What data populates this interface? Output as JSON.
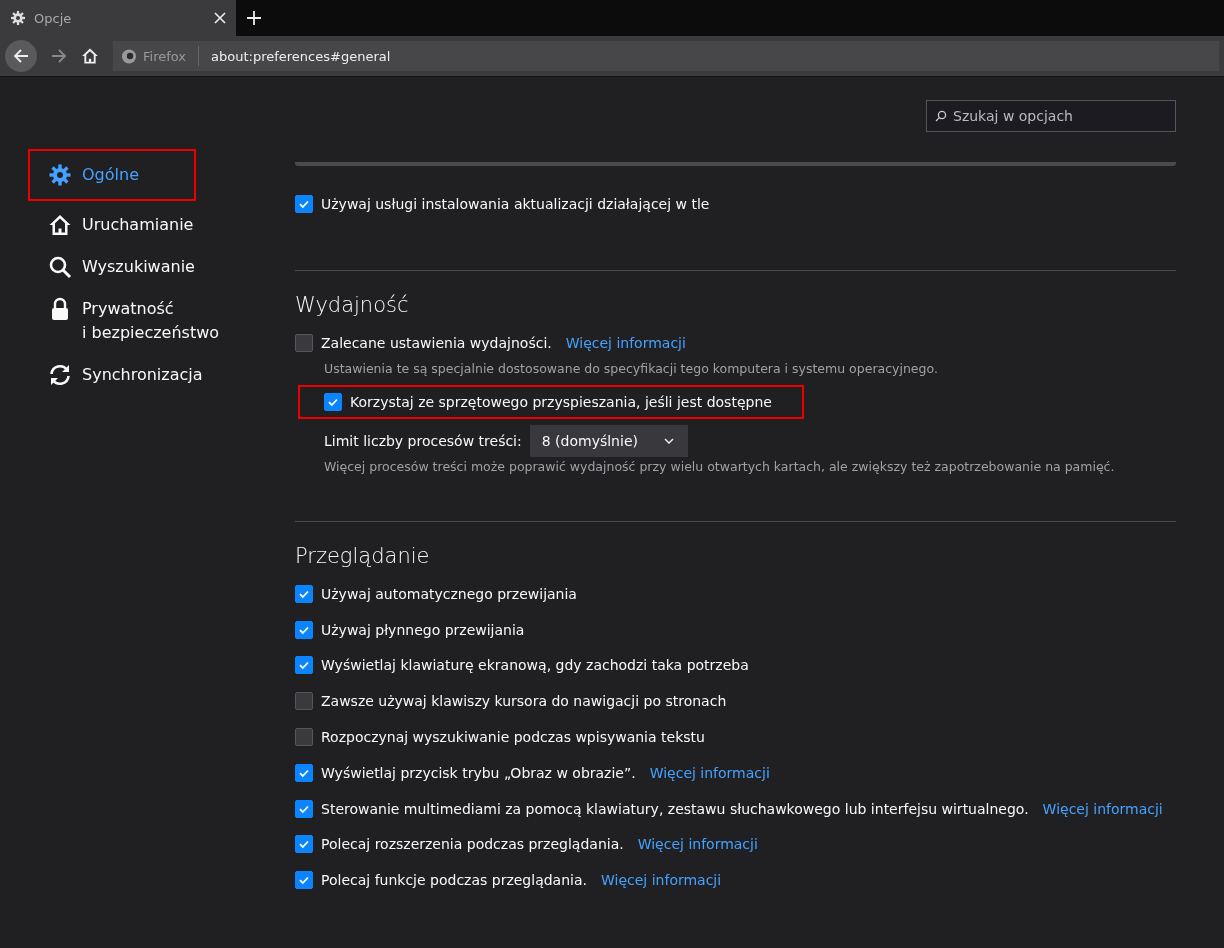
{
  "tabs": [
    {
      "label": "Opcje",
      "selected": true
    }
  ],
  "toolbar": {
    "identity": "Firefox",
    "url": "about:preferences#general"
  },
  "search": {
    "placeholder": "Szukaj w opcjach"
  },
  "sidebar": {
    "items": [
      {
        "label": "Ogólne",
        "selected": true,
        "highlighted": true
      },
      {
        "label": "Uruchamianie",
        "selected": false,
        "highlighted": false
      },
      {
        "label": "Wyszukiwanie",
        "selected": false,
        "highlighted": false
      },
      {
        "label": "Prywatność\ni bezpieczeństwo",
        "selected": false,
        "highlighted": false
      },
      {
        "label": "Synchronizacja",
        "selected": false,
        "highlighted": false
      }
    ]
  },
  "updates": {
    "label": "Używaj usługi instalowania aktualizacji działającej w tle",
    "checked": true
  },
  "performance": {
    "title": "Wydajność",
    "recommended": {
      "label": "Zalecane ustawienia wydajności.",
      "link": "Więcej informacji",
      "checked": false
    },
    "recommended_note": "Ustawienia te są specjalnie dostosowane do specyfikacji tego komputera i systemu operacyjnego.",
    "hardware": {
      "label": "Korzystaj ze sprzętowego przyspieszania, jeśli jest dostępne",
      "checked": true,
      "highlighted": true
    },
    "process_limit": {
      "label": "Limit liczby procesów treści:",
      "value": "8 (domyślnie)"
    },
    "process_note": "Więcej procesów treści może poprawić wydajność przy wielu otwartych kartach, ale zwiększy też zapotrzebowanie na pamięć."
  },
  "browsing": {
    "title": "Przeglądanie",
    "options": [
      {
        "label": "Używaj automatycznego przewijania",
        "checked": true
      },
      {
        "label": "Używaj płynnego przewijania",
        "checked": true
      },
      {
        "label": "Wyświetlaj klawiaturę ekranową, gdy zachodzi taka potrzeba",
        "checked": true
      },
      {
        "label": "Zawsze używaj klawiszy kursora do nawigacji po stronach",
        "checked": false
      },
      {
        "label": "Rozpoczynaj wyszukiwanie podczas wpisywania tekstu",
        "checked": false
      },
      {
        "label": "Wyświetlaj przycisk trybu „Obraz w obrazie”.",
        "link": "Więcej informacji",
        "checked": true
      },
      {
        "label": "Sterowanie multimediami za pomocą klawiatury, zestawu słuchawkowego lub interfejsu wirtualnego.",
        "link": "Więcej informacji",
        "checked": true
      },
      {
        "label": "Polecaj rozszerzenia podczas przeglądania.",
        "link": "Więcej informacji",
        "checked": true
      },
      {
        "label": "Polecaj funkcje podczas przeglądania.",
        "link": "Więcej informacji",
        "checked": true
      }
    ]
  }
}
